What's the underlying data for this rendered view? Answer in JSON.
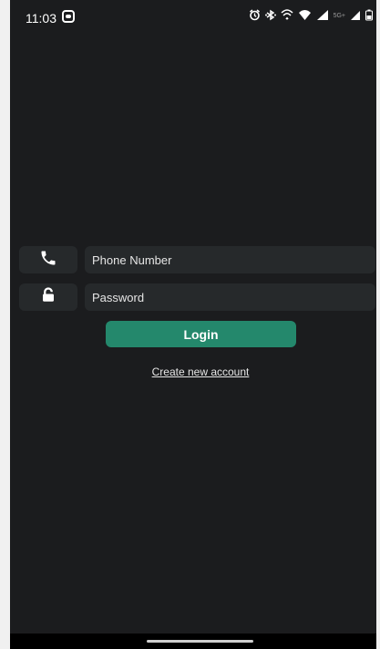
{
  "status_bar": {
    "time": "11:03",
    "network": "5G+"
  },
  "login_form": {
    "phone_placeholder": "Phone Number",
    "password_placeholder": "Password",
    "login_label": "Login",
    "create_account_label": "Create new account"
  },
  "colors": {
    "background": "#1b1c1e",
    "field_background": "#26292b",
    "accent": "#24886c"
  },
  "icons": {
    "phone_field": "phone-icon",
    "password_field": "unlock-icon"
  }
}
